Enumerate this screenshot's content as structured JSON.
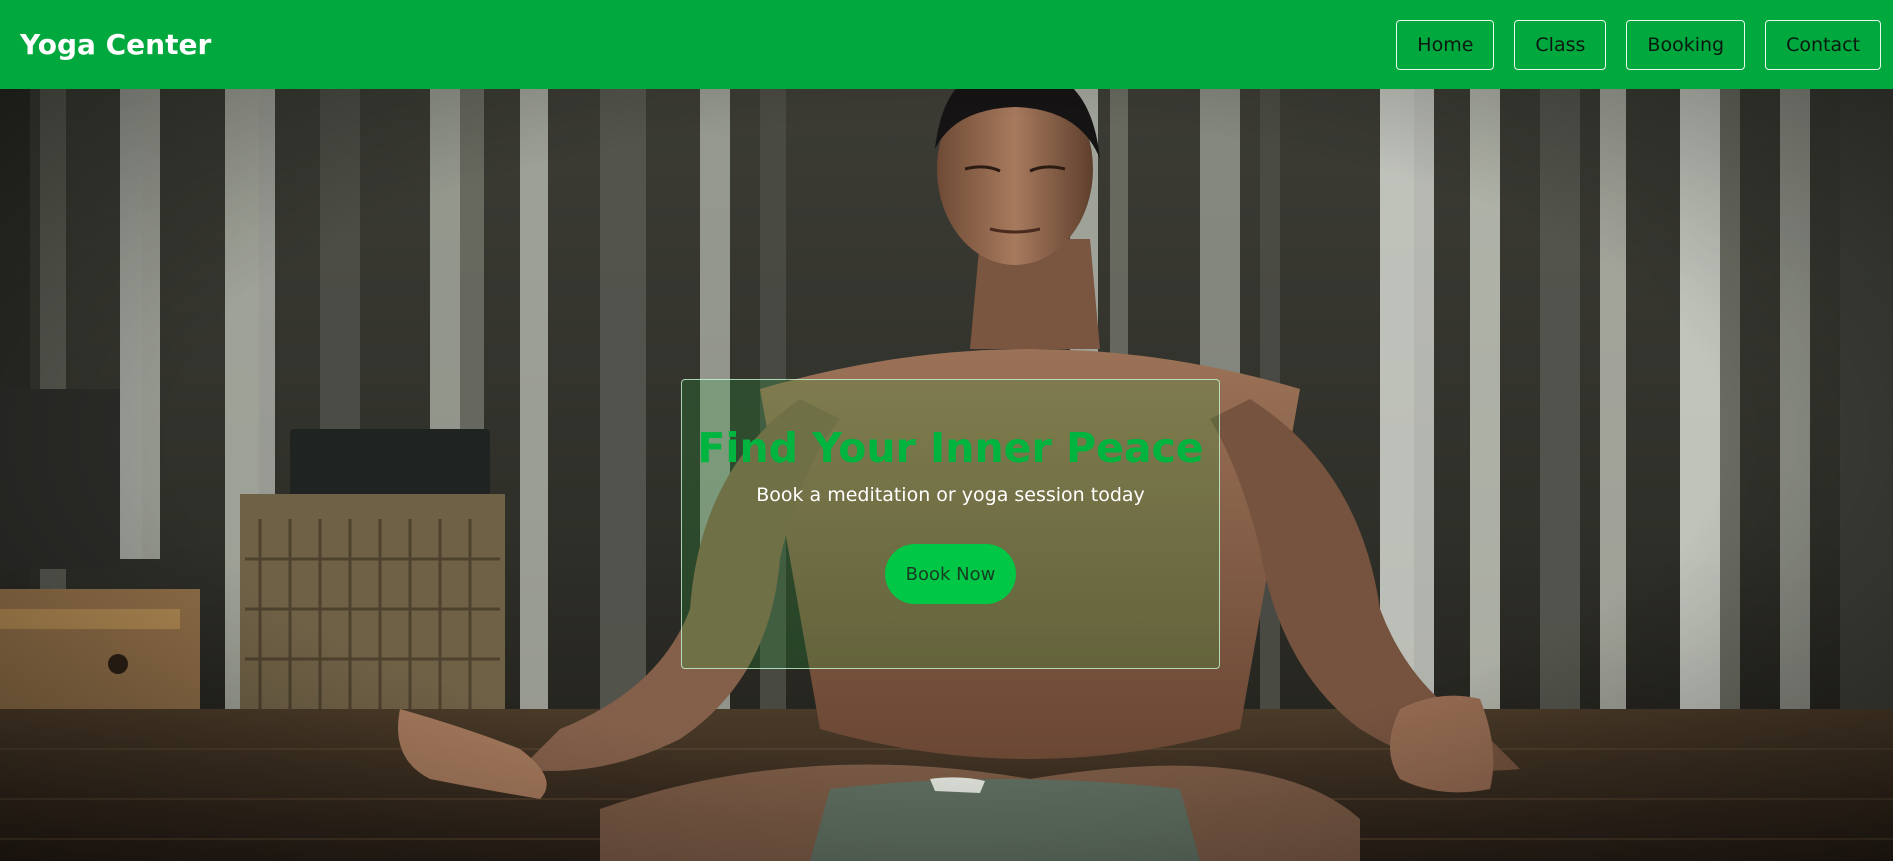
{
  "header": {
    "brand": "Yoga Center",
    "nav": [
      {
        "label": "Home"
      },
      {
        "label": "Class"
      },
      {
        "label": "Booking"
      },
      {
        "label": "Contact"
      }
    ]
  },
  "hero": {
    "title": "Find Your Inner Peace",
    "subtitle": "Book a meditation or yoga session today",
    "cta": "Book Now"
  },
  "colors": {
    "brand_green": "#00a83d",
    "title_green": "#00b53f",
    "button_green": "#00c745"
  }
}
